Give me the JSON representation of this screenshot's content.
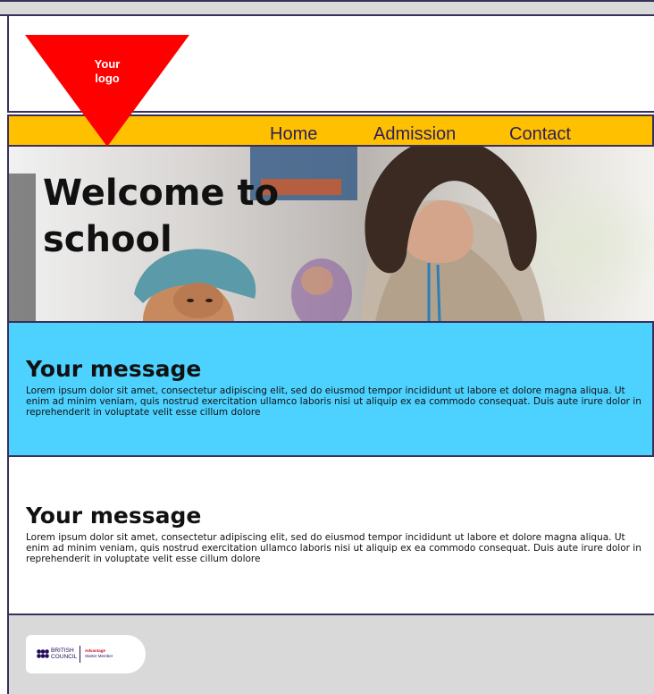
{
  "logo": {
    "line1": "Your",
    "line2": "logo",
    "color": "#ff0000"
  },
  "nav": {
    "items": [
      "Home",
      "Admission",
      "Contact"
    ],
    "background": "#ffc000"
  },
  "hero": {
    "title_line1": "Welcome to",
    "title_line2": "school"
  },
  "sections": [
    {
      "title": "Your message",
      "body": "Lorem ipsum dolor sit amet, consectetur adipiscing elit, sed do eiusmod tempor incididunt ut labore et dolore magna aliqua. Ut enim ad minim veniam, quis nostrud exercitation ullamco laboris nisi ut aliquip ex ea commodo consequat. Duis aute irure dolor in reprehenderit in voluptate velit esse cillum dolore",
      "background": "#4dd2ff"
    },
    {
      "title": "Your message",
      "body": "Lorem ipsum dolor sit amet, consectetur adipiscing elit, sed do eiusmod tempor incididunt ut labore et dolore magna aliqua. Ut enim ad minim veniam, quis nostrud exercitation ullamco laboris nisi ut aliquip ex ea commodo consequat. Duis aute irure dolor in reprehenderit in voluptate velit esse cillum dolore",
      "background": "#ffffff"
    }
  ],
  "footer": {
    "badge": {
      "org_line1": "BRITISH",
      "org_line2": "COUNCIL",
      "tier_line1": "Advantage",
      "tier_line2": "Starter Member"
    }
  }
}
